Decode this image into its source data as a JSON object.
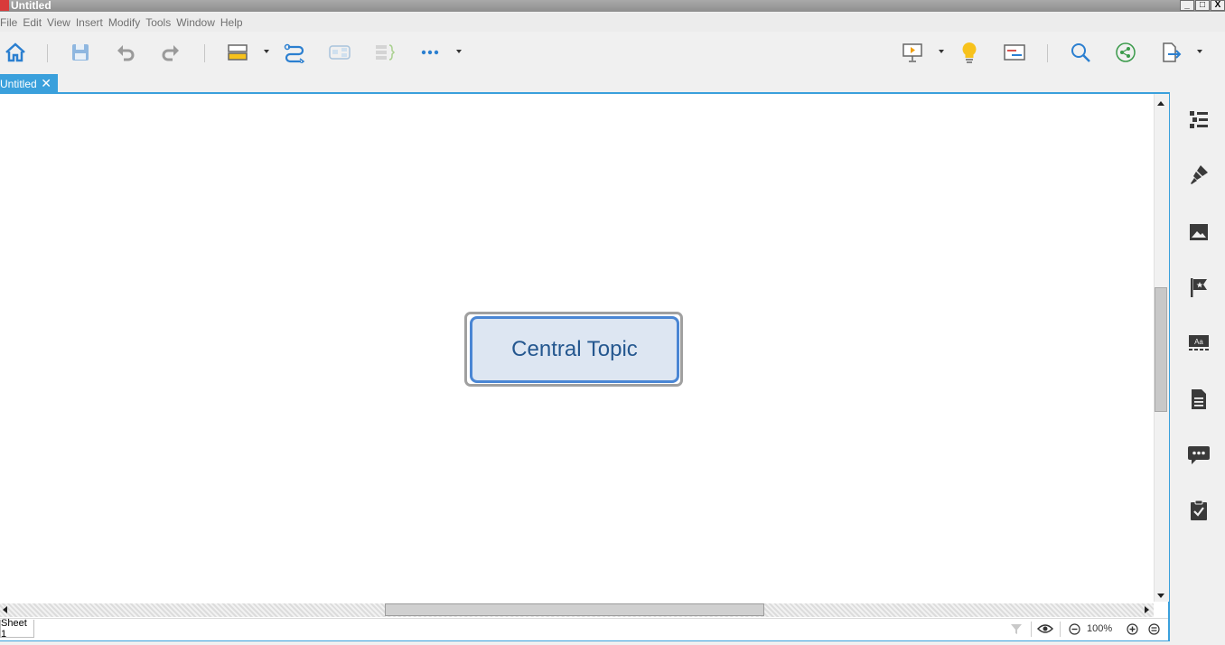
{
  "window": {
    "title": "Untitled",
    "controls": [
      "_",
      "□",
      "X"
    ]
  },
  "menu": [
    "File",
    "Edit",
    "View",
    "Insert",
    "Modify",
    "Tools",
    "Window",
    "Help"
  ],
  "toolbar": {
    "icons": [
      "home-icon",
      "save-icon",
      "undo-icon",
      "redo-icon",
      "insert-topic-icon",
      "relationship-icon",
      "boundary-icon",
      "summary-icon",
      "more-icon",
      "presentation-icon",
      "brainstorm-icon",
      "gantt-icon",
      "search-icon",
      "share-icon",
      "export-icon"
    ]
  },
  "tabs": [
    {
      "label": "Untitled",
      "close": "✕"
    }
  ],
  "canvas": {
    "central_topic": "Central Topic",
    "topic_fill": "#dde6f2",
    "topic_border": "#4a86d4",
    "topic_text_color": "#24578f"
  },
  "status": {
    "sheet": "Sheet 1",
    "zoom": "100%"
  },
  "sidebar": {
    "icons": [
      "outliner-icon",
      "format-icon",
      "image-icon",
      "marker-icon",
      "text-style-icon",
      "notes-icon",
      "comments-icon",
      "task-icon"
    ]
  },
  "colors": {
    "accent": "#3aa0dc"
  }
}
